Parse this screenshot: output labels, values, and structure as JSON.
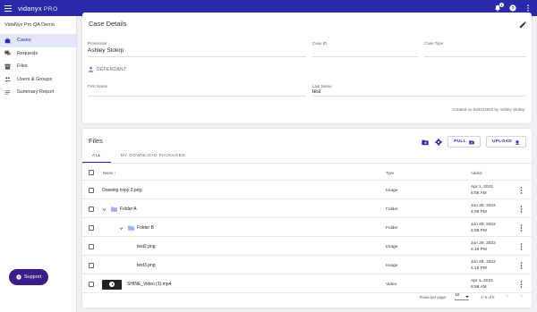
{
  "header": {
    "brand": "vidanyx",
    "brand_suffix": "PRO",
    "notification_count": "1"
  },
  "sidebar": {
    "org_name": "VidaNyx Pro QA Demo",
    "items": [
      {
        "label": "Cases",
        "icon": "briefcase-icon",
        "active": true
      },
      {
        "label": "Requests",
        "icon": "chat-icon",
        "active": false
      },
      {
        "label": "Files",
        "icon": "archive-icon",
        "active": false
      },
      {
        "label": "Users & Groups",
        "icon": "people-icon",
        "active": false
      },
      {
        "label": "Summary Report",
        "icon": "list-icon",
        "active": false
      }
    ],
    "support_label": "Support"
  },
  "case_details": {
    "title": "Case Details",
    "prosecutor_label": "Prosecutor",
    "prosecutor_value": "Ashley Stokrp",
    "case_id_label": "Case ID",
    "case_type_label": "Case Type",
    "defendant_heading": "DEFENDANT",
    "first_name_label": "First Name",
    "last_name_label": "Last Name",
    "last_name_value": "test",
    "created_text": "Created on 04/01/2022 by Ashley Stokrp"
  },
  "files": {
    "title": "Files",
    "pull_label": "PULL",
    "upload_label": "UPLOAD",
    "tabs": [
      "ALL",
      "MY DOWNLOAD PACKAGES"
    ],
    "columns": {
      "name": "Name",
      "type": "Type",
      "added": "Added"
    },
    "rows": [
      {
        "name": "Drawing copy 2.png",
        "type": "Image",
        "date": "Apr 1, 2022",
        "time": "6:58 AM"
      },
      {
        "name": "Folder A",
        "type": "Folder",
        "date": "Jun 29, 2022",
        "time": "4:09 PM"
      },
      {
        "name": "Folder B",
        "type": "Folder",
        "date": "Jun 29, 2022",
        "time": "4:09 PM"
      },
      {
        "name": "test2.png",
        "type": "Image",
        "date": "Jun 29, 2022",
        "time": "4:19 PM"
      },
      {
        "name": "test3.png",
        "type": "Image",
        "date": "Jun 29, 2022",
        "time": "4:19 PM"
      },
      {
        "name": "SHINE_Video (1).mp4",
        "type": "Video",
        "date": "Apr 1, 2022",
        "time": "6:58 AM"
      }
    ],
    "pagination": {
      "rows_per_page_label": "Rows per page:",
      "rows_per_page": "10",
      "range": "1–6 of 6"
    }
  },
  "colors": {
    "primary": "#2a2aa8",
    "support": "#3b1d8a",
    "active_nav_bg": "#e3e6f7"
  }
}
